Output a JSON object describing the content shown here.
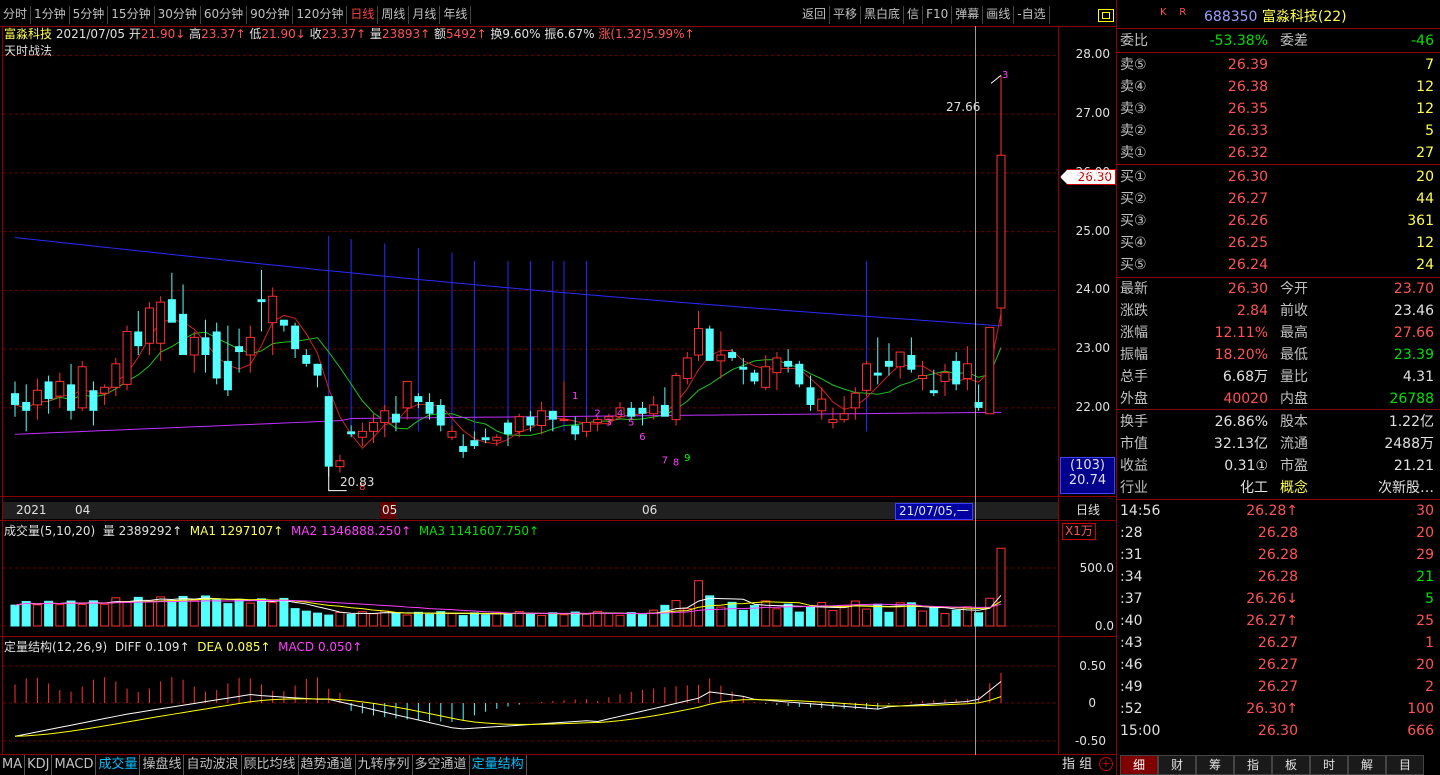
{
  "toolbar": {
    "left": [
      "分时",
      "1分钟",
      "5分钟",
      "15分钟",
      "30分钟",
      "60分钟",
      "90分钟",
      "120分钟",
      "日线",
      "周线",
      "月线",
      "年线"
    ],
    "active": "日线",
    "right": [
      "返回",
      "平移",
      "黑白底",
      "信",
      "F10",
      "弹幕",
      "画线",
      "-自选"
    ]
  },
  "stock": {
    "name": "富淼科技",
    "date": "2021/07/05",
    "open_lbl": "开",
    "open": "21.90↓",
    "high_lbl": "高",
    "high": "23.37↑",
    "low_lbl": "低",
    "low": "21.90↓",
    "close_lbl": "收",
    "close": "23.37↑",
    "vol_lbl": "量",
    "vol": "23893↑",
    "amt_lbl": "额",
    "amt": "5492↑",
    "turnover": "换9.60%",
    "amplitude": "振6.67%",
    "change": "涨(1.32)5.99%↑",
    "indicator": "天时战法"
  },
  "price_axis": [
    "28.00",
    "27.00",
    "26.00",
    "25.00",
    "24.00",
    "23.00",
    "22.00"
  ],
  "price_tag": "26.30",
  "cursor_box": {
    "top": "(103)",
    "bottom": "20.74"
  },
  "annotations": {
    "peak": "27.66",
    "low": "20.83",
    "top_num": "3"
  },
  "time_axis": {
    "year": "2021",
    "m1": "04",
    "m2": "05",
    "m3": "06",
    "cursor": "21/07/05,一",
    "period": "日线"
  },
  "volume": {
    "title": "成交量(5,10,20)",
    "v_lbl": "量",
    "v": "2389292↑",
    "ma1": "MA1 1297107↑",
    "ma2": "MA2 1346888.250↑",
    "ma3": "MA3 1141607.750↑",
    "unit": "X1万",
    "axis": [
      "500.0",
      "0.0"
    ]
  },
  "macd": {
    "title": "定量结构(12,26,9)",
    "diff": "DIFF 0.109↑",
    "dea": "DEA 0.085↑",
    "macd": "MACD 0.050↑",
    "axis": [
      "0.50",
      "0",
      "-0.50"
    ]
  },
  "quote": {
    "code": "688350",
    "name": "富淼科技(22)",
    "wb_lbl": "委比",
    "wb": "-53.38%",
    "wc_lbl": "委差",
    "wc": "-46",
    "asks": [
      {
        "l": "卖⑤",
        "p": "26.39",
        "v": "7"
      },
      {
        "l": "卖④",
        "p": "26.38",
        "v": "12"
      },
      {
        "l": "卖③",
        "p": "26.35",
        "v": "12"
      },
      {
        "l": "卖②",
        "p": "26.33",
        "v": "5"
      },
      {
        "l": "卖①",
        "p": "26.32",
        "v": "27"
      }
    ],
    "bids": [
      {
        "l": "买①",
        "p": "26.30",
        "v": "20"
      },
      {
        "l": "买②",
        "p": "26.27",
        "v": "44"
      },
      {
        "l": "买③",
        "p": "26.26",
        "v": "361"
      },
      {
        "l": "买④",
        "p": "26.25",
        "v": "12"
      },
      {
        "l": "买⑤",
        "p": "26.24",
        "v": "24"
      }
    ],
    "stats": [
      {
        "a": "最新",
        "b": "26.30",
        "c": "今开",
        "d": "23.70",
        "bc": "red",
        "dc": "red"
      },
      {
        "a": "涨跌",
        "b": "2.84",
        "c": "前收",
        "d": "23.46",
        "bc": "red",
        "dc": "wht"
      },
      {
        "a": "涨幅",
        "b": "12.11%",
        "c": "最高",
        "d": "27.66",
        "bc": "red",
        "dc": "red"
      },
      {
        "a": "振幅",
        "b": "18.20%",
        "c": "最低",
        "d": "23.39",
        "bc": "red",
        "dc": "grn"
      },
      {
        "a": "总手",
        "b": "6.68万",
        "c": "量比",
        "d": "4.31",
        "bc": "wht",
        "dc": "wht"
      },
      {
        "a": "外盘",
        "b": "40020",
        "c": "内盘",
        "d": "26788",
        "bc": "red",
        "dc": "grn"
      }
    ],
    "stats2": [
      {
        "a": "换手",
        "b": "26.86%",
        "c": "股本",
        "d": "1.22亿"
      },
      {
        "a": "市值",
        "b": "32.13亿",
        "c": "流通",
        "d": "2488万"
      },
      {
        "a": "收益",
        "b": "0.31①",
        "c": "市盈",
        "d": "21.21"
      }
    ],
    "industry_lbl": "行业",
    "industry": "化工",
    "concept_lbl": "概念",
    "concept": "次新股…"
  },
  "ticks": [
    {
      "t": "14:56",
      "p": "26.28↑",
      "v": "30",
      "pc": "red",
      "vc": "red"
    },
    {
      "t": ":28",
      "p": "26.28",
      "v": "20",
      "pc": "red",
      "vc": "red"
    },
    {
      "t": ":31",
      "p": "26.28",
      "v": "29",
      "pc": "red",
      "vc": "red"
    },
    {
      "t": ":34",
      "p": "26.28",
      "v": "21",
      "pc": "red",
      "vc": "grn"
    },
    {
      "t": ":37",
      "p": "26.26↓",
      "v": "5",
      "pc": "red",
      "vc": "grn"
    },
    {
      "t": ":40",
      "p": "26.27↑",
      "v": "25",
      "pc": "red",
      "vc": "red"
    },
    {
      "t": ":43",
      "p": "26.27",
      "v": "1",
      "pc": "red",
      "vc": "red"
    },
    {
      "t": ":46",
      "p": "26.27",
      "v": "20",
      "pc": "red",
      "vc": "red"
    },
    {
      "t": ":49",
      "p": "26.27",
      "v": "2",
      "pc": "red",
      "vc": "red"
    },
    {
      "t": ":52",
      "p": "26.30↑",
      "v": "100",
      "pc": "red",
      "vc": "red"
    },
    {
      "t": "15:00",
      "p": "26.30",
      "v": "666",
      "pc": "red",
      "vc": "red"
    }
  ],
  "bottom_tabs": [
    "MA",
    "KDJ",
    "MACD",
    "成交量",
    "操盘线",
    "自动波浪",
    "顾比均线",
    "趋势通道",
    "九转序列",
    "多空通道",
    "定量结构"
  ],
  "bottom_active": [
    "成交量",
    "定量结构"
  ],
  "right_bottom": "指 组",
  "mt_tabs": [
    "细",
    "财",
    "筹",
    "指",
    "板",
    "时",
    "解",
    "目"
  ],
  "mt_active": "细",
  "candles": [
    [
      22.25,
      22.45,
      21.85,
      22.05
    ],
    [
      22.1,
      22.4,
      21.6,
      21.95
    ],
    [
      22.05,
      22.5,
      21.8,
      22.3
    ],
    [
      22.45,
      22.55,
      21.9,
      22.15
    ],
    [
      22.2,
      22.6,
      22.0,
      22.45
    ],
    [
      22.4,
      22.75,
      21.8,
      21.95
    ],
    [
      22.0,
      22.8,
      21.95,
      22.7
    ],
    [
      22.3,
      22.45,
      21.7,
      21.95
    ],
    [
      22.25,
      22.4,
      22.05,
      22.35
    ],
    [
      22.35,
      22.85,
      22.2,
      22.75
    ],
    [
      22.4,
      23.4,
      22.3,
      23.3
    ],
    [
      23.3,
      23.65,
      22.9,
      23.05
    ],
    [
      23.1,
      23.8,
      22.9,
      23.7
    ],
    [
      23.1,
      23.9,
      22.8,
      23.8
    ],
    [
      23.85,
      24.3,
      23.5,
      23.45
    ],
    [
      23.6,
      24.1,
      23.0,
      22.9
    ],
    [
      22.9,
      23.3,
      22.6,
      23.2
    ],
    [
      23.2,
      23.5,
      22.6,
      22.9
    ],
    [
      23.3,
      23.45,
      22.4,
      22.5
    ],
    [
      22.8,
      23.4,
      22.2,
      22.3
    ],
    [
      23.05,
      23.35,
      22.6,
      22.95
    ],
    [
      22.9,
      23.4,
      22.6,
      23.2
    ],
    [
      23.85,
      24.35,
      23.3,
      23.8
    ],
    [
      23.45,
      24.05,
      22.9,
      23.9
    ],
    [
      23.5,
      23.5,
      23.3,
      23.4
    ],
    [
      23.4,
      23.45,
      22.85,
      23.0
    ],
    [
      22.9,
      23.0,
      22.7,
      22.75
    ],
    [
      22.75,
      22.75,
      22.35,
      22.55
    ],
    [
      22.2,
      22.2,
      20.83,
      21.0
    ],
    [
      21.0,
      21.2,
      20.9,
      21.1
    ],
    [
      21.6,
      21.7,
      21.5,
      21.55
    ],
    [
      21.5,
      21.75,
      21.35,
      21.6
    ],
    [
      21.6,
      21.9,
      21.4,
      21.75
    ],
    [
      21.75,
      22.05,
      21.5,
      21.95
    ],
    [
      21.9,
      22.2,
      21.6,
      21.75
    ],
    [
      22.0,
      22.45,
      21.8,
      22.45
    ],
    [
      22.2,
      22.25,
      22.0,
      22.1
    ],
    [
      22.1,
      22.25,
      21.8,
      21.9
    ],
    [
      22.05,
      22.15,
      21.6,
      21.7
    ],
    [
      21.5,
      21.7,
      21.45,
      21.6
    ],
    [
      21.35,
      21.55,
      21.15,
      21.25
    ],
    [
      21.45,
      21.6,
      21.3,
      21.35
    ],
    [
      21.5,
      21.65,
      21.4,
      21.45
    ],
    [
      21.45,
      21.55,
      21.35,
      21.5
    ],
    [
      21.75,
      21.8,
      21.35,
      21.55
    ],
    [
      21.6,
      21.9,
      21.5,
      21.85
    ],
    [
      21.85,
      21.95,
      21.6,
      21.7
    ],
    [
      21.7,
      22.1,
      21.55,
      21.95
    ],
    [
      21.95,
      21.95,
      21.6,
      21.8
    ],
    [
      21.8,
      22.45,
      21.8,
      21.8
    ],
    [
      21.7,
      21.85,
      21.45,
      21.55
    ],
    [
      21.6,
      21.85,
      21.5,
      21.75
    ],
    [
      21.75,
      21.85,
      21.6,
      21.8
    ],
    [
      21.8,
      21.9,
      21.7,
      21.85
    ],
    [
      21.85,
      22.1,
      21.8,
      22.0
    ],
    [
      22.0,
      22.1,
      21.8,
      21.85
    ],
    [
      22.0,
      22.1,
      21.7,
      21.9
    ],
    [
      21.9,
      22.2,
      21.8,
      22.05
    ],
    [
      22.05,
      22.35,
      21.9,
      21.85
    ],
    [
      21.8,
      22.6,
      21.7,
      22.55
    ],
    [
      22.5,
      22.95,
      22.4,
      22.85
    ],
    [
      22.9,
      23.65,
      22.8,
      23.35
    ],
    [
      23.35,
      23.4,
      22.9,
      22.8
    ],
    [
      22.8,
      23.3,
      22.5,
      22.9
    ],
    [
      22.95,
      23.0,
      22.8,
      22.85
    ],
    [
      22.7,
      22.85,
      22.4,
      22.65
    ],
    [
      22.6,
      22.65,
      22.4,
      22.45
    ],
    [
      22.35,
      22.9,
      22.3,
      22.7
    ],
    [
      22.6,
      22.95,
      22.3,
      22.85
    ],
    [
      22.8,
      23.0,
      22.6,
      22.7
    ],
    [
      22.75,
      22.8,
      22.35,
      22.4
    ],
    [
      22.35,
      22.55,
      21.95,
      22.05
    ],
    [
      21.95,
      22.35,
      21.8,
      22.15
    ],
    [
      21.75,
      22.0,
      21.65,
      21.8
    ],
    [
      21.8,
      22.2,
      21.75,
      21.9
    ],
    [
      22.0,
      22.35,
      21.8,
      22.25
    ],
    [
      22.3,
      22.8,
      22.2,
      22.75
    ],
    [
      22.6,
      23.2,
      22.4,
      22.55
    ],
    [
      22.8,
      23.1,
      22.55,
      22.7
    ],
    [
      22.7,
      22.95,
      22.5,
      22.95
    ],
    [
      22.9,
      23.2,
      22.6,
      22.65
    ],
    [
      22.5,
      22.8,
      22.3,
      22.55
    ],
    [
      22.3,
      22.65,
      22.2,
      22.25
    ],
    [
      22.45,
      22.75,
      22.2,
      22.6
    ],
    [
      22.8,
      22.95,
      22.3,
      22.4
    ],
    [
      22.5,
      23.05,
      22.3,
      22.75
    ],
    [
      22.1,
      22.4,
      21.95,
      22.0
    ],
    [
      21.9,
      23.37,
      21.9,
      23.37
    ],
    [
      23.7,
      27.66,
      23.39,
      26.3
    ]
  ]
}
